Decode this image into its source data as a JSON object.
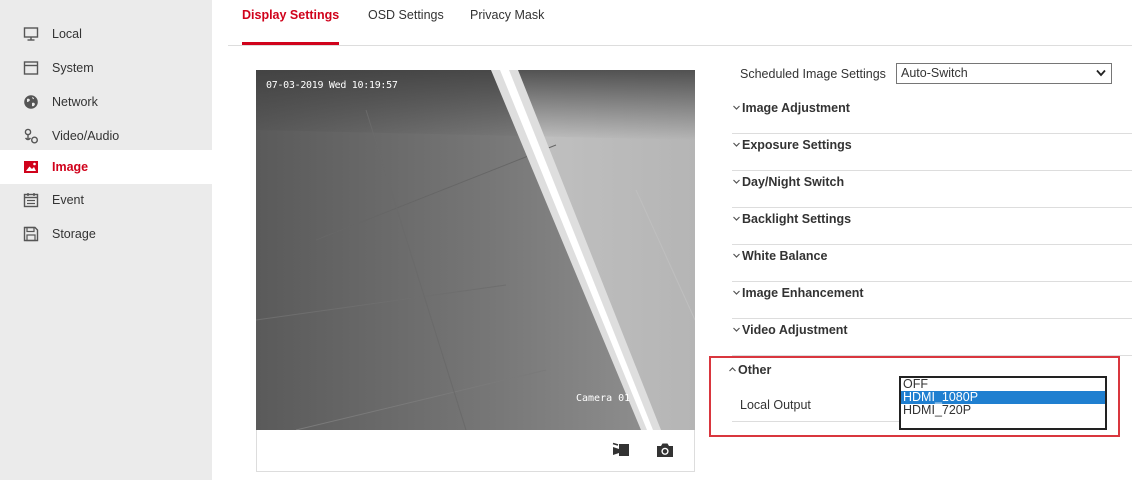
{
  "sidebar": {
    "items": [
      {
        "label": "Local",
        "icon": "monitor-icon"
      },
      {
        "label": "System",
        "icon": "window-icon"
      },
      {
        "label": "Network",
        "icon": "globe-icon"
      },
      {
        "label": "Video/Audio",
        "icon": "video-audio-icon"
      },
      {
        "label": "Image",
        "icon": "image-icon",
        "active": true
      },
      {
        "label": "Event",
        "icon": "calendar-icon"
      },
      {
        "label": "Storage",
        "icon": "storage-icon"
      }
    ]
  },
  "tabs": [
    {
      "label": "Display Settings",
      "active": true
    },
    {
      "label": "OSD Settings"
    },
    {
      "label": "Privacy Mask"
    }
  ],
  "video": {
    "timestamp": "07-03-2019 Wed 10:19:57",
    "camera_name": "Camera 01",
    "controls": [
      {
        "icon": "record-icon"
      },
      {
        "icon": "camera-snapshot-icon"
      }
    ]
  },
  "scheduled": {
    "label": "Scheduled Image Settings",
    "value": "Auto-Switch"
  },
  "sections": [
    {
      "label": "Image Adjustment",
      "state": "collapsed"
    },
    {
      "label": "Exposure Settings",
      "state": "collapsed"
    },
    {
      "label": "Day/Night Switch",
      "state": "collapsed"
    },
    {
      "label": "Backlight Settings",
      "state": "collapsed"
    },
    {
      "label": "White Balance",
      "state": "collapsed"
    },
    {
      "label": "Image Enhancement",
      "state": "collapsed"
    },
    {
      "label": "Video Adjustment",
      "state": "collapsed"
    }
  ],
  "other": {
    "label": "Other",
    "state": "expanded",
    "local_output": {
      "label": "Local Output",
      "options": [
        "OFF",
        "HDMI_1080P",
        "HDMI_720P"
      ],
      "highlighted": "HDMI_1080P"
    }
  },
  "colors": {
    "accent": "#d0021b",
    "highlight_box": "#d9363e",
    "selection": "#1f7fd0",
    "sidebar_bg": "#ebebeb"
  }
}
